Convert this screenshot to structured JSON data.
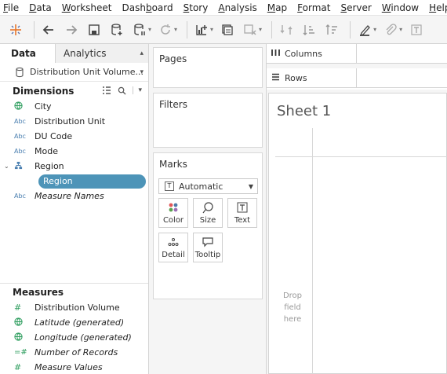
{
  "menu": [
    {
      "label": "File",
      "u": "F",
      "rest": "ile"
    },
    {
      "label": "Data",
      "u": "D",
      "rest": "ata"
    },
    {
      "label": "Worksheet",
      "u": "W",
      "rest": "orksheet"
    },
    {
      "label": "Dashboard",
      "u": "Dash",
      "rest": "board",
      "ufirst": false,
      "pre": "Dash",
      "ul": "b",
      "post": "oard"
    },
    {
      "label": "Story",
      "u": "S",
      "rest": "tory"
    },
    {
      "label": "Analysis",
      "u": "A",
      "rest": "nalysis"
    },
    {
      "label": "Map",
      "u": "M",
      "rest": "ap"
    },
    {
      "label": "Format",
      "u": "F",
      "rest": "ormat"
    },
    {
      "label": "Server",
      "u": "S",
      "rest": "erver"
    },
    {
      "label": "Window",
      "u": "W",
      "rest": "indow"
    },
    {
      "label": "Help",
      "u": "H",
      "rest": "elp"
    }
  ],
  "datapane": {
    "tab_data": "Data",
    "tab_analytics": "Analytics",
    "datasource": "Distribution Unit Volume...",
    "dimensions_header": "Dimensions",
    "dimensions": [
      {
        "name": "City",
        "type": "geo"
      },
      {
        "name": "Distribution Unit",
        "type": "Abc"
      },
      {
        "name": "DU Code",
        "type": "Abc"
      },
      {
        "name": "Mode",
        "type": "Abc"
      },
      {
        "name": "Region",
        "type": "hier"
      },
      {
        "name": "Region",
        "type": "Abc",
        "selected": true
      },
      {
        "name": "Measure Names",
        "type": "Abc",
        "italic": true
      }
    ],
    "measures_header": "Measures",
    "measures": [
      {
        "name": "Distribution Volume",
        "type": "#"
      },
      {
        "name": "Latitude (generated)",
        "type": "geo",
        "italic": true
      },
      {
        "name": "Longitude (generated)",
        "type": "geo",
        "italic": true
      },
      {
        "name": "Number of Records",
        "type": "=#",
        "italic": true
      },
      {
        "name": "Measure Values",
        "type": "#",
        "italic": true
      }
    ]
  },
  "cards": {
    "pages": "Pages",
    "filters": "Filters",
    "marks": "Marks",
    "marks_type": "Automatic",
    "color": "Color",
    "size": "Size",
    "text": "Text",
    "detail": "Detail",
    "tooltip": "Tooltip"
  },
  "shelves": {
    "columns": "Columns",
    "rows": "Rows"
  },
  "sheet": {
    "title": "Sheet 1",
    "drop_line1": "Drop",
    "drop_line2": "field",
    "drop_line3": "here"
  },
  "colors": {
    "selected_pill": "#4d94b8",
    "geo_icon": "#2f9e5f",
    "abc_icon": "#4a7fb0"
  }
}
